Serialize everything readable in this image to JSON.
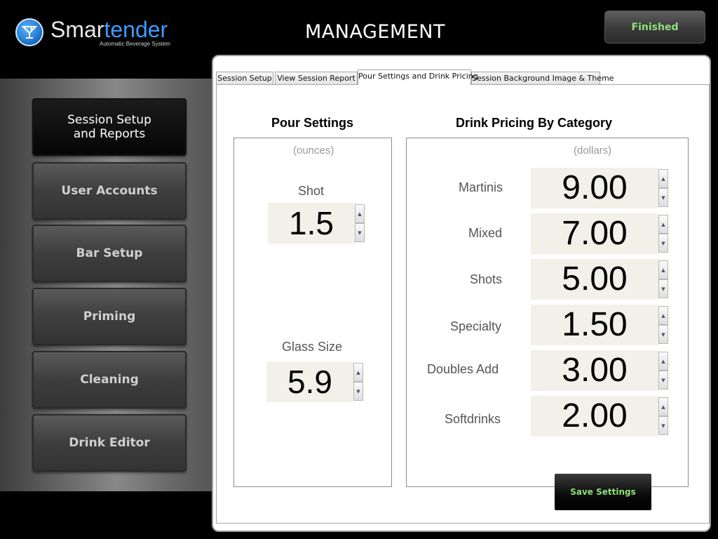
{
  "header": {
    "logo_prefix": "Smar",
    "logo_accent": "tender",
    "logo_tagline": "Automatic Beverage System",
    "title": "MANAGEMENT",
    "finished_label": "Finished"
  },
  "nav": {
    "items": [
      {
        "label": "Session Setup and Reports",
        "active": true
      },
      {
        "label": "User Accounts",
        "active": false
      },
      {
        "label": "Bar Setup",
        "active": false
      },
      {
        "label": "Priming",
        "active": false
      },
      {
        "label": "Cleaning",
        "active": false
      },
      {
        "label": "Drink Editor",
        "active": false
      }
    ]
  },
  "tabs": [
    {
      "label": "Session Setup",
      "active": false
    },
    {
      "label": "View Session Report",
      "active": false
    },
    {
      "label": "Pour Settings and Drink Pricing",
      "active": true
    },
    {
      "label": "Session Background Image & Theme",
      "active": false
    }
  ],
  "pour_settings": {
    "title": "Pour Settings",
    "unit": "(ounces)",
    "fields": [
      {
        "label": "Shot",
        "value": "1.5"
      },
      {
        "label": "Glass Size",
        "value": "5.9"
      }
    ]
  },
  "drink_pricing": {
    "title": "Drink Pricing By Category",
    "unit": "(dollars)",
    "fields": [
      {
        "label": "Martinis",
        "value": "9.00"
      },
      {
        "label": "Mixed",
        "value": "7.00"
      },
      {
        "label": "Shots",
        "value": "5.00"
      },
      {
        "label": "Specialty",
        "value": "1.50"
      },
      {
        "label": "Doubles Add",
        "value": "3.00"
      },
      {
        "label": "Softdrinks",
        "value": "2.00"
      }
    ],
    "save_label": "Save Settings"
  },
  "colors": {
    "accent_green": "#8fe07a",
    "logo_blue": "#3d9bff",
    "field_bg": "#f2f0e8"
  }
}
